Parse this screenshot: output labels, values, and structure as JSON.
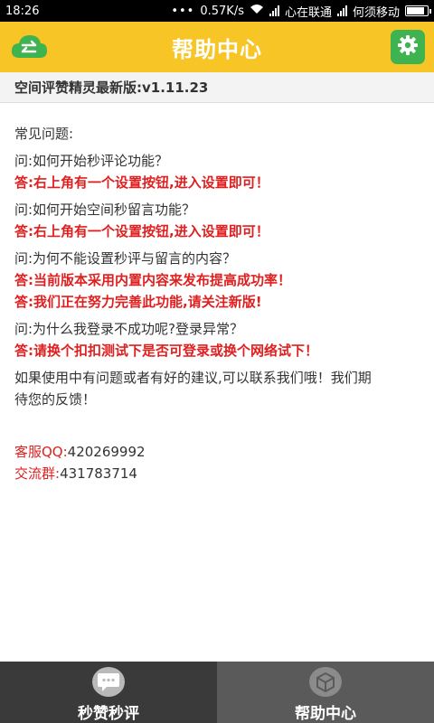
{
  "status_bar": {
    "time": "18:26",
    "dots": "•••",
    "speed": "0.57K/s",
    "carrier1": "心在联通",
    "carrier2": "何须移动",
    "battery_level": 0.85
  },
  "header": {
    "title": "帮助中心",
    "left_icon": "swap-arrows-icon",
    "right_icon": "gear-icon",
    "accent_color": "#f7c526",
    "icon_green": "#3fb34f"
  },
  "version": "空间评赞精灵最新版:v1.11.23",
  "faq": {
    "intro": "常见问题:",
    "items": [
      {
        "q": "问:如何开始秒评论功能？",
        "a": [
          "答:右上角有一个设置按钮,进入设置即可！"
        ]
      },
      {
        "q": "问:如何开始空间秒留言功能？",
        "a": [
          "答:右上角有一个设置按钮,进入设置即可！"
        ]
      },
      {
        "q": "问:为何不能设置秒评与留言的内容？",
        "a": [
          "答:当前版本采用内置内容来发布提高成功率！",
          "答:我们正在努力完善此功能,请关注新版!"
        ]
      },
      {
        "q": "问:为什么我登录不成功呢?登录异常？",
        "a": [
          "答:请换个扣扣测试下是否可登录或换个网络试下！"
        ]
      }
    ],
    "contact_line1": "如果使用中有问题或者有好的建议,可以联系我们哦！我们期",
    "contact_line2": "待您的反馈！"
  },
  "contacts": {
    "qq_label": "客服QQ:",
    "qq_value": "420269992",
    "group_label": "交流群:",
    "group_value": "431783714"
  },
  "tabs": [
    {
      "label": "秒赞秒评",
      "icon": "chat-bubble-icon"
    },
    {
      "label": "帮助中心",
      "icon": "cube-icon"
    }
  ]
}
